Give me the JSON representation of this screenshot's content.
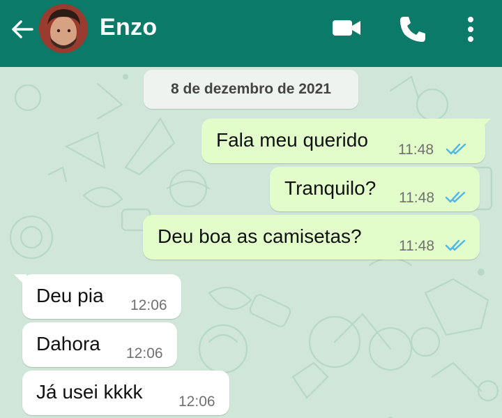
{
  "header": {
    "contact_name": "Enzo",
    "background_color": "#0b7a68",
    "icons": [
      "back-arrow-icon",
      "video-call-icon",
      "phone-call-icon",
      "more-options-icon"
    ]
  },
  "chat": {
    "date_separator": "8 de dezembro de 2021",
    "messages": [
      {
        "direction": "outgoing",
        "text": "Fala meu querido",
        "time": "11:48",
        "status": "read"
      },
      {
        "direction": "outgoing",
        "text": "Tranquilo?",
        "time": "11:48",
        "status": "read"
      },
      {
        "direction": "outgoing",
        "text": "Deu boa as camisetas?",
        "time": "11:48",
        "status": "read"
      },
      {
        "direction": "incoming",
        "text": "Deu pia",
        "time": "12:06"
      },
      {
        "direction": "incoming",
        "text": "Dahora",
        "time": "12:06"
      },
      {
        "direction": "incoming",
        "text": "Já usei kkkk",
        "time": "12:06"
      }
    ]
  },
  "colors": {
    "outgoing_bubble": "#e2fdca",
    "incoming_bubble": "#ffffff",
    "read_ticks": "#4fb6ec",
    "wallpaper": "#cfe6d9"
  }
}
